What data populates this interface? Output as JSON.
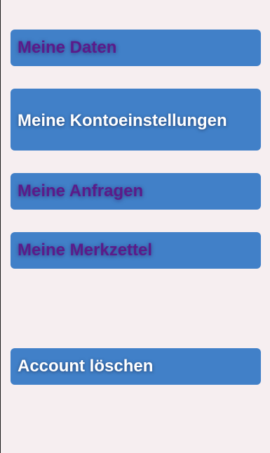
{
  "menu": {
    "my_data": "Meine Daten",
    "account_settings": "Meine Kontoeinstellungen",
    "my_requests": "Meine Anfragen",
    "my_watchlist": "Meine Merkzettel",
    "delete_account": "Account löschen"
  },
  "colors": {
    "background": "#f6eef0",
    "button": "#4180c8",
    "visited_text": "#5b1b8a",
    "active_text": "#ffffff"
  }
}
